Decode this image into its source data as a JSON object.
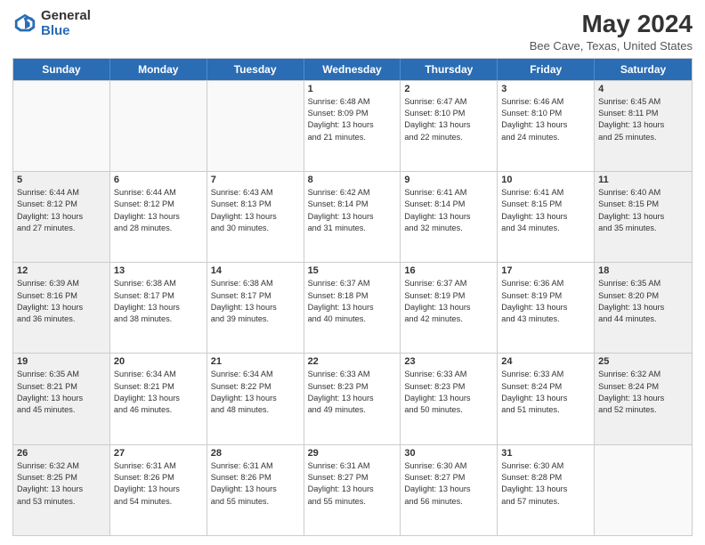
{
  "logo": {
    "general": "General",
    "blue": "Blue"
  },
  "header": {
    "title": "May 2024",
    "subtitle": "Bee Cave, Texas, United States"
  },
  "days_of_week": [
    "Sunday",
    "Monday",
    "Tuesday",
    "Wednesday",
    "Thursday",
    "Friday",
    "Saturday"
  ],
  "weeks": [
    [
      {
        "day": "",
        "info": "",
        "empty": true
      },
      {
        "day": "",
        "info": "",
        "empty": true
      },
      {
        "day": "",
        "info": "",
        "empty": true
      },
      {
        "day": "1",
        "info": "Sunrise: 6:48 AM\nSunset: 8:09 PM\nDaylight: 13 hours\nand 21 minutes.",
        "shaded": false
      },
      {
        "day": "2",
        "info": "Sunrise: 6:47 AM\nSunset: 8:10 PM\nDaylight: 13 hours\nand 22 minutes.",
        "shaded": false
      },
      {
        "day": "3",
        "info": "Sunrise: 6:46 AM\nSunset: 8:10 PM\nDaylight: 13 hours\nand 24 minutes.",
        "shaded": false
      },
      {
        "day": "4",
        "info": "Sunrise: 6:45 AM\nSunset: 8:11 PM\nDaylight: 13 hours\nand 25 minutes.",
        "shaded": true
      }
    ],
    [
      {
        "day": "5",
        "info": "Sunrise: 6:44 AM\nSunset: 8:12 PM\nDaylight: 13 hours\nand 27 minutes.",
        "shaded": true
      },
      {
        "day": "6",
        "info": "Sunrise: 6:44 AM\nSunset: 8:12 PM\nDaylight: 13 hours\nand 28 minutes.",
        "shaded": false
      },
      {
        "day": "7",
        "info": "Sunrise: 6:43 AM\nSunset: 8:13 PM\nDaylight: 13 hours\nand 30 minutes.",
        "shaded": false
      },
      {
        "day": "8",
        "info": "Sunrise: 6:42 AM\nSunset: 8:14 PM\nDaylight: 13 hours\nand 31 minutes.",
        "shaded": false
      },
      {
        "day": "9",
        "info": "Sunrise: 6:41 AM\nSunset: 8:14 PM\nDaylight: 13 hours\nand 32 minutes.",
        "shaded": false
      },
      {
        "day": "10",
        "info": "Sunrise: 6:41 AM\nSunset: 8:15 PM\nDaylight: 13 hours\nand 34 minutes.",
        "shaded": false
      },
      {
        "day": "11",
        "info": "Sunrise: 6:40 AM\nSunset: 8:15 PM\nDaylight: 13 hours\nand 35 minutes.",
        "shaded": true
      }
    ],
    [
      {
        "day": "12",
        "info": "Sunrise: 6:39 AM\nSunset: 8:16 PM\nDaylight: 13 hours\nand 36 minutes.",
        "shaded": true
      },
      {
        "day": "13",
        "info": "Sunrise: 6:38 AM\nSunset: 8:17 PM\nDaylight: 13 hours\nand 38 minutes.",
        "shaded": false
      },
      {
        "day": "14",
        "info": "Sunrise: 6:38 AM\nSunset: 8:17 PM\nDaylight: 13 hours\nand 39 minutes.",
        "shaded": false
      },
      {
        "day": "15",
        "info": "Sunrise: 6:37 AM\nSunset: 8:18 PM\nDaylight: 13 hours\nand 40 minutes.",
        "shaded": false
      },
      {
        "day": "16",
        "info": "Sunrise: 6:37 AM\nSunset: 8:19 PM\nDaylight: 13 hours\nand 42 minutes.",
        "shaded": false
      },
      {
        "day": "17",
        "info": "Sunrise: 6:36 AM\nSunset: 8:19 PM\nDaylight: 13 hours\nand 43 minutes.",
        "shaded": false
      },
      {
        "day": "18",
        "info": "Sunrise: 6:35 AM\nSunset: 8:20 PM\nDaylight: 13 hours\nand 44 minutes.",
        "shaded": true
      }
    ],
    [
      {
        "day": "19",
        "info": "Sunrise: 6:35 AM\nSunset: 8:21 PM\nDaylight: 13 hours\nand 45 minutes.",
        "shaded": true
      },
      {
        "day": "20",
        "info": "Sunrise: 6:34 AM\nSunset: 8:21 PM\nDaylight: 13 hours\nand 46 minutes.",
        "shaded": false
      },
      {
        "day": "21",
        "info": "Sunrise: 6:34 AM\nSunset: 8:22 PM\nDaylight: 13 hours\nand 48 minutes.",
        "shaded": false
      },
      {
        "day": "22",
        "info": "Sunrise: 6:33 AM\nSunset: 8:23 PM\nDaylight: 13 hours\nand 49 minutes.",
        "shaded": false
      },
      {
        "day": "23",
        "info": "Sunrise: 6:33 AM\nSunset: 8:23 PM\nDaylight: 13 hours\nand 50 minutes.",
        "shaded": false
      },
      {
        "day": "24",
        "info": "Sunrise: 6:33 AM\nSunset: 8:24 PM\nDaylight: 13 hours\nand 51 minutes.",
        "shaded": false
      },
      {
        "day": "25",
        "info": "Sunrise: 6:32 AM\nSunset: 8:24 PM\nDaylight: 13 hours\nand 52 minutes.",
        "shaded": true
      }
    ],
    [
      {
        "day": "26",
        "info": "Sunrise: 6:32 AM\nSunset: 8:25 PM\nDaylight: 13 hours\nand 53 minutes.",
        "shaded": true
      },
      {
        "day": "27",
        "info": "Sunrise: 6:31 AM\nSunset: 8:26 PM\nDaylight: 13 hours\nand 54 minutes.",
        "shaded": false
      },
      {
        "day": "28",
        "info": "Sunrise: 6:31 AM\nSunset: 8:26 PM\nDaylight: 13 hours\nand 55 minutes.",
        "shaded": false
      },
      {
        "day": "29",
        "info": "Sunrise: 6:31 AM\nSunset: 8:27 PM\nDaylight: 13 hours\nand 55 minutes.",
        "shaded": false
      },
      {
        "day": "30",
        "info": "Sunrise: 6:30 AM\nSunset: 8:27 PM\nDaylight: 13 hours\nand 56 minutes.",
        "shaded": false
      },
      {
        "day": "31",
        "info": "Sunrise: 6:30 AM\nSunset: 8:28 PM\nDaylight: 13 hours\nand 57 minutes.",
        "shaded": false
      },
      {
        "day": "",
        "info": "",
        "empty": true
      }
    ]
  ]
}
